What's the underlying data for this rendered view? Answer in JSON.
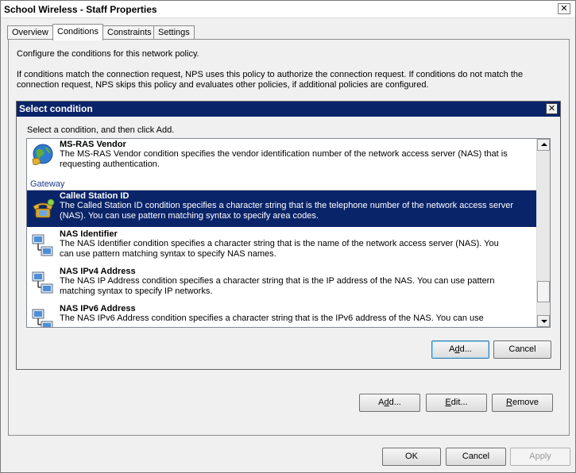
{
  "window": {
    "title": "School Wireless - Staff Properties",
    "close_glyph": "✕"
  },
  "tabs": [
    {
      "label": "Overview"
    },
    {
      "label": "Conditions",
      "active": true
    },
    {
      "label": "Constraints"
    },
    {
      "label": "Settings"
    }
  ],
  "panel": {
    "intro": "Configure the conditions for this network policy.",
    "explanation_line1": "If conditions match the connection request, NPS uses this policy to authorize the connection request. If conditions do not match the",
    "explanation_line2": "connection request, NPS skips this policy and evaluates other policies, if additional policies are configured."
  },
  "select_dialog": {
    "title": "Select condition",
    "close_glyph": "✕",
    "instruction": "Select a condition, and then click Add.",
    "group_label": "Gateway",
    "items": [
      {
        "name": "MS-RAS Vendor",
        "desc_line1": "The MS-RAS Vendor condition specifies the vendor identification number of the network access server (NAS) that is",
        "desc_line2": "requesting authentication.",
        "icon": "globe-phone-icon"
      },
      {
        "name": "Called Station ID",
        "desc_line1": "The Called Station ID condition specifies a character string that is the telephone number of the network access server",
        "desc_line2": "(NAS). You can use pattern matching syntax to specify area codes.",
        "icon": "telephone-icon",
        "selected": true
      },
      {
        "name": "NAS Identifier",
        "desc_line1": "The NAS Identifier condition specifies a character string that is the name of the network access server (NAS). You",
        "desc_line2": "can use pattern matching syntax to specify NAS names.",
        "icon": "network-computer-icon"
      },
      {
        "name": "NAS IPv4 Address",
        "desc_line1": "The NAS IP Address condition specifies a character string that is the IP address of the NAS. You can use pattern",
        "desc_line2": "matching syntax to specify IP networks.",
        "icon": "network-computer-icon"
      },
      {
        "name": "NAS IPv6 Address",
        "desc_line1": "The NAS IPv6 Address condition specifies a character string that is the IPv6 address of the NAS. You can use",
        "desc_line2": "",
        "icon": "network-computer-icon"
      }
    ],
    "add_button": {
      "pre": "A",
      "u": "d",
      "post": "d..."
    },
    "cancel_button": "Cancel"
  },
  "panel_buttons": {
    "add": {
      "pre": "A",
      "u": "d",
      "post": "d..."
    },
    "edit": {
      "pre": "",
      "u": "E",
      "post": "dit..."
    },
    "remove": {
      "pre": "",
      "u": "R",
      "post": "emove"
    }
  },
  "footer_buttons": {
    "ok": "OK",
    "cancel": "Cancel",
    "apply": "Apply"
  },
  "colors": {
    "selection": "#0a246a",
    "dialog_title": "#0a246a",
    "group_label": "#1e3a8a"
  }
}
